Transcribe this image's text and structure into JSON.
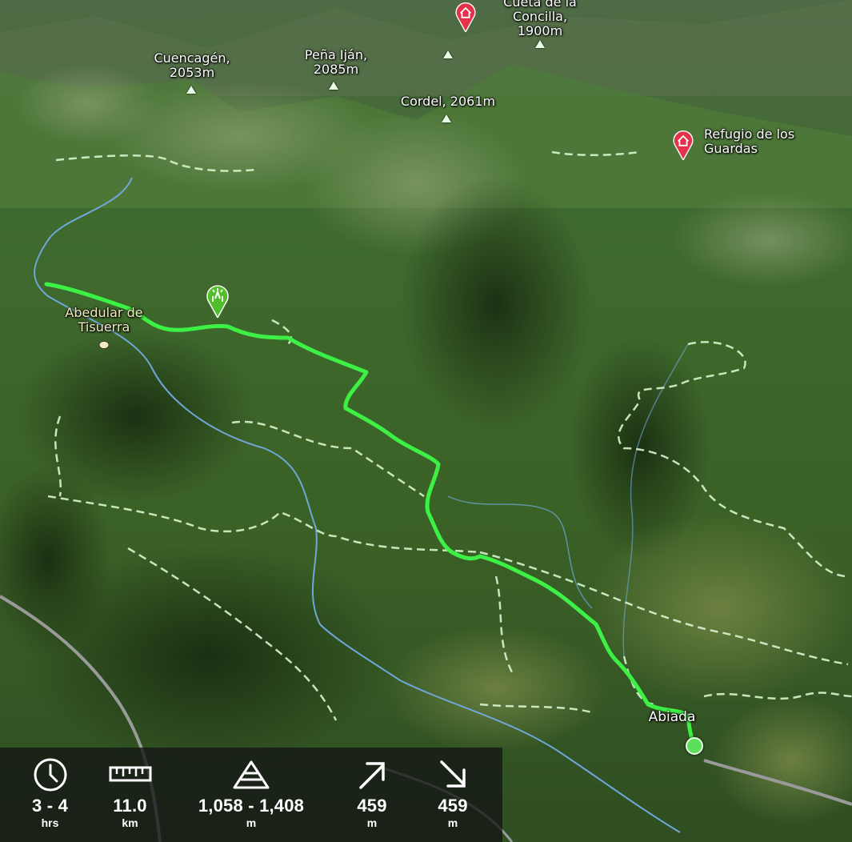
{
  "map": {
    "peaks": [
      {
        "name": "Cuencagén,",
        "elev": "2053m"
      },
      {
        "name": "Peña Iján,",
        "elev": "2085m"
      },
      {
        "name": "Cordel, 2061m",
        "elev": ""
      },
      {
        "name": "Cueta de la",
        "elev": "Concilla,"
      },
      {
        "name": "",
        "elev": "1900m"
      }
    ],
    "huts": [
      {
        "name": "Refugio de los",
        "name2": "Guardas"
      }
    ],
    "places": {
      "abedular": "Abedular de",
      "abedular2": "Tisuerra",
      "village": "Abiada"
    },
    "colors": {
      "route": "#3cf046",
      "trail": "#d8f5cf",
      "river": "#6fa7d8",
      "road": "#8a8a8a",
      "hut_pin": "#e3324a",
      "poi_pin": "#4fbf2a"
    }
  },
  "stats": {
    "duration": {
      "value": "3 - 4",
      "unit": "hrs",
      "icon": "clock-icon"
    },
    "distance": {
      "value": "11.0",
      "unit": "km",
      "icon": "ruler-icon"
    },
    "elevation_range": {
      "value": "1,058 - 1,408",
      "unit": "m",
      "icon": "elevation-icon"
    },
    "ascent": {
      "value": "459",
      "unit": "m",
      "icon": "ascent-arrow-icon"
    },
    "descent": {
      "value": "459",
      "unit": "m",
      "icon": "descent-arrow-icon"
    }
  }
}
